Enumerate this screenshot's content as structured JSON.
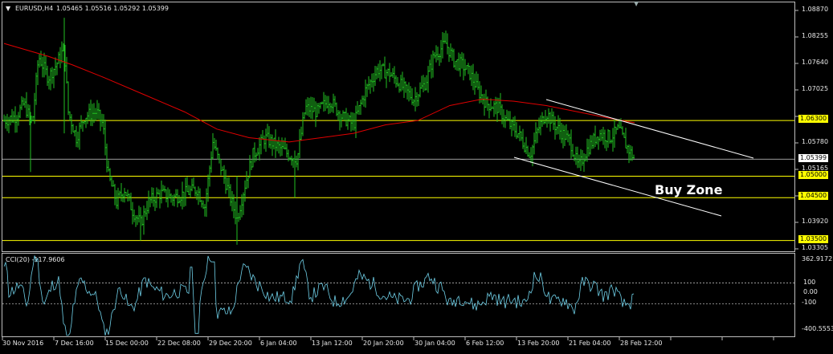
{
  "header": {
    "symbol": "EURUSD,H4",
    "ohlc": "1.05465 1.05516 1.05292 1.05399"
  },
  "indicator": {
    "label": "CCI(20) -117.9606",
    "axis_top": "362.9172",
    "axis_bottom": "-400.5553",
    "levels": [
      "100",
      "0.00",
      "-100"
    ]
  },
  "price_axis": [
    "1.08870",
    "1.08255",
    "1.07640",
    "1.07025",
    "1.05780",
    "1.05165",
    "1.03920",
    "1.03305"
  ],
  "current_price": "1.05399",
  "levels": [
    {
      "label": "1.06300",
      "color": "#ffff00"
    },
    {
      "label": "1.05000",
      "color": "#ffff00"
    },
    {
      "label": "1.04500",
      "color": "#ffff00"
    },
    {
      "label": "1.03500",
      "color": "#ffff00"
    }
  ],
  "annotation": {
    "text": "Buy Zone"
  },
  "time_axis": [
    "30 Nov 2016",
    "7 Dec 16:00",
    "15 Dec 00:00",
    "22 Dec 08:00",
    "29 Dec 20:00",
    "6 Jan 04:00",
    "13 Jan 12:00",
    "20 Jan 20:00",
    "30 Jan 04:00",
    "6 Feb 12:00",
    "13 Feb 20:00",
    "21 Feb 04:00",
    "28 Feb 12:00"
  ],
  "colors": {
    "bars": "#22c022",
    "ma": "#e00000",
    "levels": "#ffff00",
    "channel": "#ffffff",
    "cci": "#6fd0e8",
    "background": "#000000"
  }
}
